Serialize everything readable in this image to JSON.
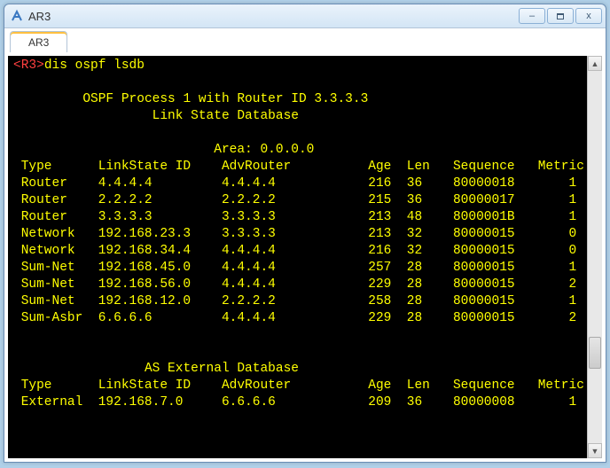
{
  "window": {
    "title": "AR3",
    "tab": "AR3",
    "minimize": "–",
    "close": "x"
  },
  "terminal": {
    "prompt_host": "<R3>",
    "command": "dis ospf lsdb",
    "process_line": "OSPF Process 1 with Router ID 3.3.3.3",
    "db_line": "Link State Database",
    "area_line": "Area: 0.0.0.0",
    "headers": "Type      LinkState ID    AdvRouter          Age  Len   Sequence   Metric",
    "rows": [
      "Router    4.4.4.4         4.4.4.4            216  36    80000018       1",
      "Router    2.2.2.2         2.2.2.2            215  36    80000017       1",
      "Router    3.3.3.3         3.3.3.3            213  48    8000001B       1",
      "Network   192.168.23.3    3.3.3.3            213  32    80000015       0",
      "Network   192.168.34.4    4.4.4.4            216  32    80000015       0",
      "Sum-Net   192.168.45.0    4.4.4.4            257  28    80000015       1",
      "Sum-Net   192.168.56.0    4.4.4.4            229  28    80000015       2",
      "Sum-Net   192.168.12.0    2.2.2.2            258  28    80000015       1",
      "Sum-Asbr  6.6.6.6         4.4.4.4            229  28    80000015       2"
    ],
    "ext_db_line": "AS External Database",
    "ext_headers": "Type      LinkState ID    AdvRouter          Age  Len   Sequence   Metric",
    "ext_rows": [
      "External  192.168.7.0     6.6.6.6            209  36    80000008       1"
    ]
  }
}
